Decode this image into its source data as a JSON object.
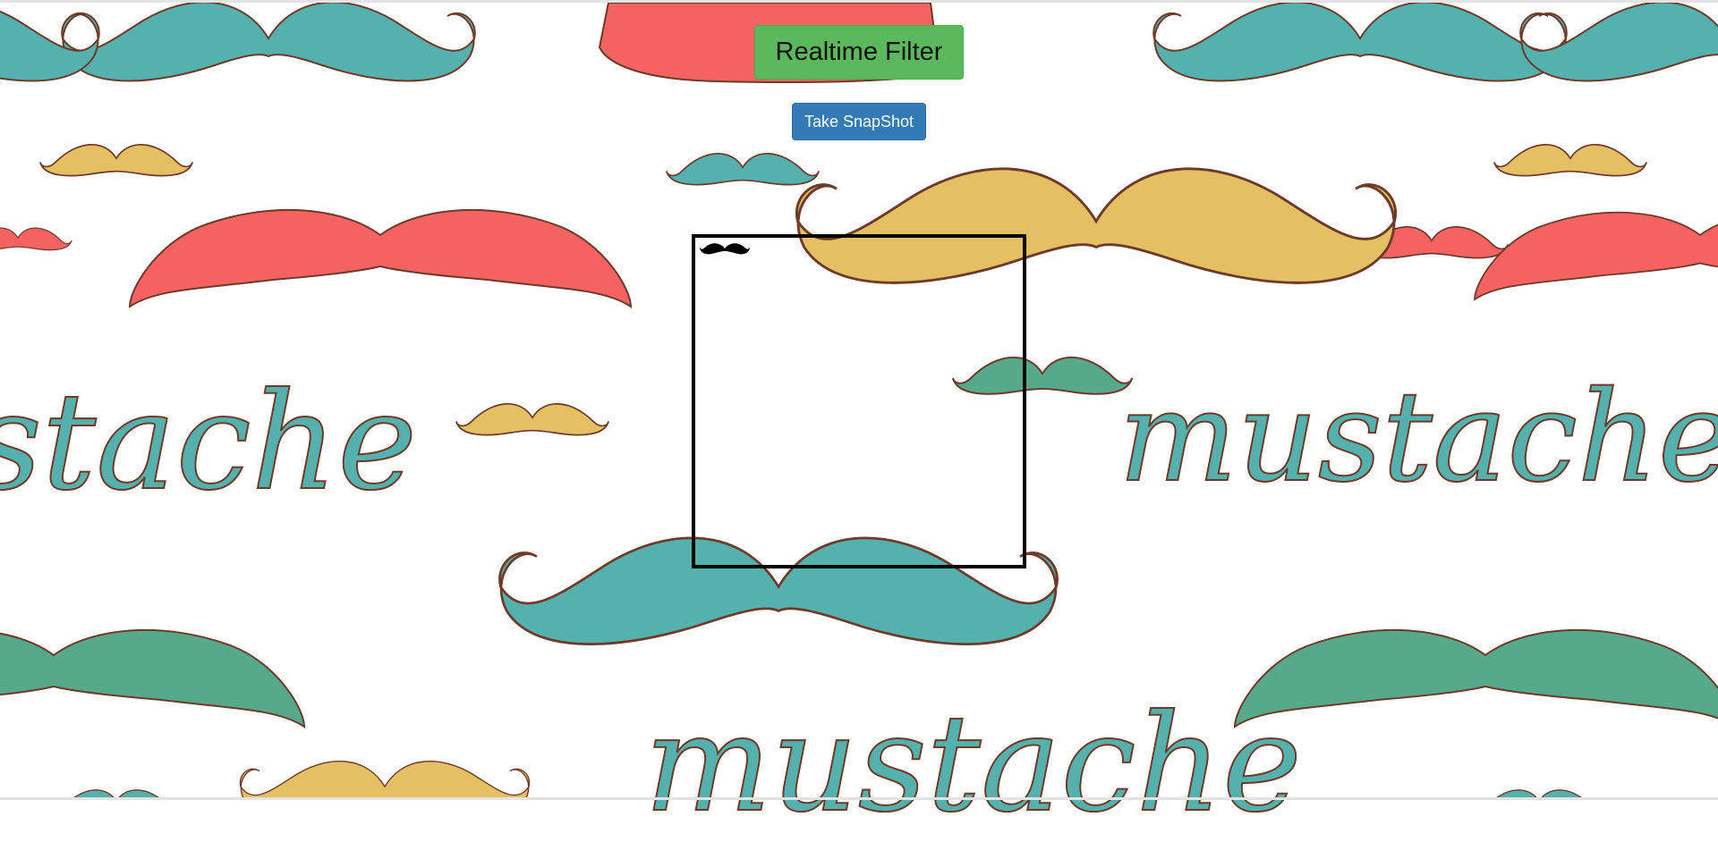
{
  "header": {
    "title_label": "Realtime Filter",
    "snapshot_label": "Take SnapShot"
  },
  "background": {
    "pattern_words": [
      "stache",
      "mustache",
      "mustache"
    ],
    "colors": {
      "teal": "#55b1ae",
      "red": "#f46262",
      "gold": "#e4c063",
      "green": "#57a98c",
      "outline": "#6e3a2a"
    }
  },
  "camera": {
    "overlay_icon": "mustache-icon",
    "frame_color": "#000000"
  }
}
